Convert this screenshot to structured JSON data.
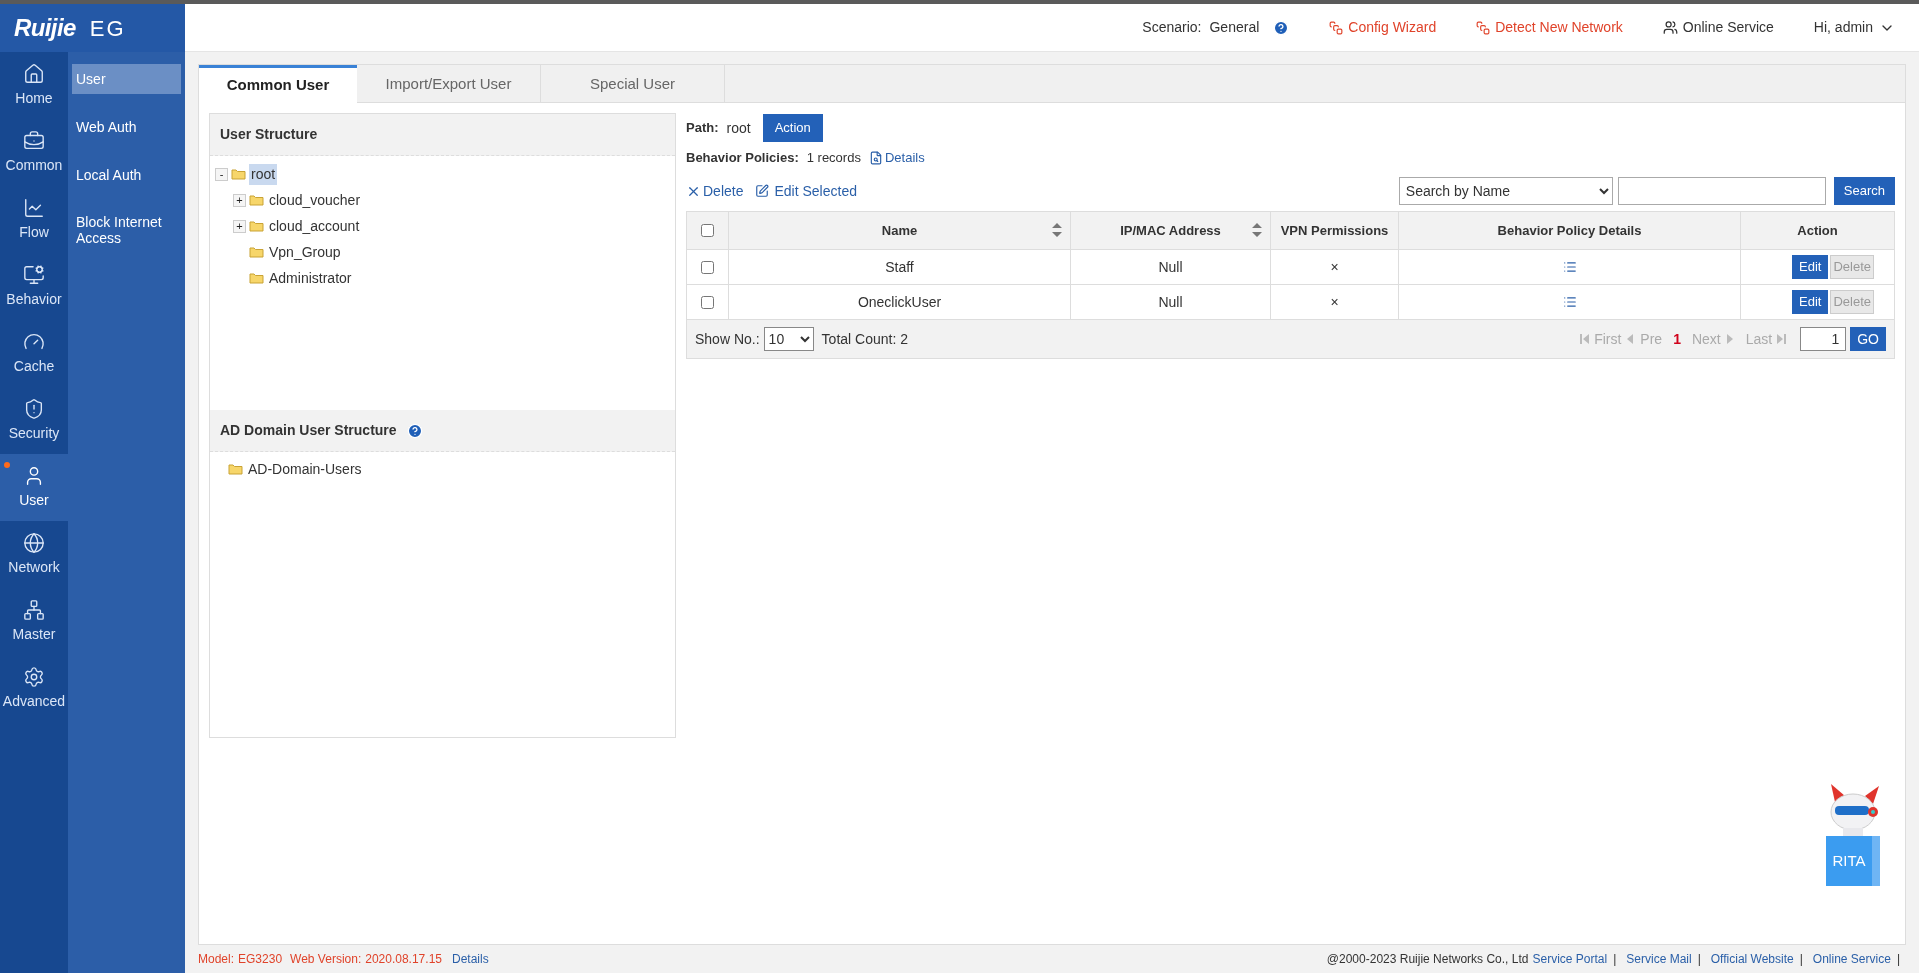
{
  "brand": {
    "logo": "Ruijie",
    "product": "EG"
  },
  "nav": [
    {
      "label": "Home",
      "selected": false,
      "notice": false
    },
    {
      "label": "Common",
      "selected": false,
      "notice": false
    },
    {
      "label": "Flow",
      "selected": false,
      "notice": false
    },
    {
      "label": "Behavior",
      "selected": false,
      "notice": false
    },
    {
      "label": "Cache",
      "selected": false,
      "notice": false
    },
    {
      "label": "Security",
      "selected": false,
      "notice": false
    },
    {
      "label": "User",
      "selected": true,
      "notice": true
    },
    {
      "label": "Network",
      "selected": false,
      "notice": false
    },
    {
      "label": "Master",
      "selected": false,
      "notice": false
    },
    {
      "label": "Advanced",
      "selected": false,
      "notice": false
    }
  ],
  "submenu": [
    {
      "label": "User",
      "selected": true
    },
    {
      "label": "Web Auth",
      "selected": false
    },
    {
      "label": "Local Auth",
      "selected": false
    },
    {
      "label": "Block Internet Access",
      "selected": false
    }
  ],
  "topbar": {
    "scenario_label": "Scenario:",
    "scenario": "General",
    "links": [
      {
        "label": "Config Wizard",
        "kind": "alert"
      },
      {
        "label": "Detect New Network",
        "kind": "alert"
      },
      {
        "label": "Online Service",
        "kind": "plain"
      }
    ],
    "user": "Hi, admin"
  },
  "tabs": [
    {
      "label": "Common User",
      "selected": true
    },
    {
      "label": "Import/Export User",
      "selected": false
    },
    {
      "label": "Special User",
      "selected": false
    }
  ],
  "user_structure": {
    "title": "User Structure",
    "tree": [
      {
        "label": "root",
        "toggle": "-",
        "selected": true,
        "children": [
          {
            "label": "cloud_voucher",
            "toggle": "+",
            "selected": false
          },
          {
            "label": "cloud_account",
            "toggle": "+",
            "selected": false
          },
          {
            "label": "Vpn_Group",
            "selected": false
          },
          {
            "label": "Administrator",
            "selected": false
          }
        ]
      }
    ]
  },
  "ad_structure": {
    "title": "AD Domain User Structure",
    "tree": [
      {
        "label": "AD-Domain-Users",
        "selected": false
      }
    ]
  },
  "path": {
    "label": "Path:",
    "value": "root",
    "button": "Action"
  },
  "policies": {
    "label": "Behavior Policies:",
    "value": "1 records",
    "link": "Details"
  },
  "toolbar": {
    "delete": "Delete",
    "edit": "Edit Selected",
    "search_select": "Search by Name",
    "search_button": "Search"
  },
  "table": {
    "header_checked": false,
    "columns": [
      {
        "label": "Name",
        "sortable": true
      },
      {
        "label": "IP/MAC Address",
        "sortable": true
      },
      {
        "label": "VPN Permissions",
        "sortable": false
      },
      {
        "label": "Behavior Policy Details",
        "sortable": false
      },
      {
        "label": "Action",
        "sortable": false
      }
    ],
    "rows": [
      {
        "checked": false,
        "name": "Staff",
        "address": "Null",
        "vpn": "×",
        "edit": "Edit",
        "delete": "Delete"
      },
      {
        "checked": false,
        "name": "OneclickUser",
        "address": "Null",
        "vpn": "×",
        "edit": "Edit",
        "delete": "Delete"
      }
    ]
  },
  "pager": {
    "show_label": "Show No.:",
    "show_value": "10",
    "total": "Total Count: 2",
    "first": "First",
    "pre": "Pre",
    "current": "1",
    "next": "Next",
    "last": "Last",
    "page": "1",
    "go": "GO"
  },
  "assistant": {
    "label": "RITA"
  },
  "footer": {
    "model_label": "Model:",
    "model": "EG3230",
    "version_label": "Web Version:",
    "version": "2020.08.17.15",
    "details": "Details",
    "copyright": "@2000-2023 Ruijie Networks Co., Ltd",
    "links": [
      {
        "label": "Service Portal",
        "separator": "|"
      },
      {
        "label": "Service Mail",
        "separator": "|"
      },
      {
        "label": "Official Website",
        "separator": "|"
      },
      {
        "label": "Online Service",
        "separator": "|"
      }
    ]
  }
}
